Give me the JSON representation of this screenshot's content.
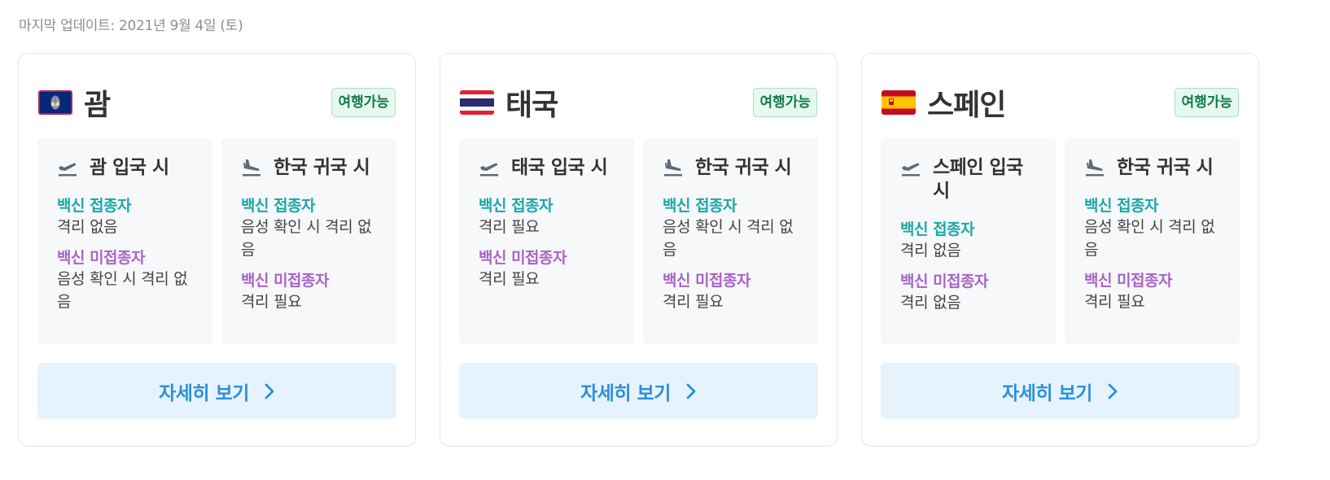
{
  "last_updated": "마지막 업데이트: 2021년 9월 4일 (토)",
  "colors": {
    "vaccinated": "#1aa8a8",
    "unvaccinated": "#a864c8",
    "badge": "#0f7b4b",
    "button": "#2b8fdc"
  },
  "cards": [
    {
      "country": "괌",
      "flag_icon": "guam-flag-icon",
      "badge": "여행가능",
      "entry": {
        "title": "괌 입국 시",
        "vaccinated_label": "백신 접종자",
        "vaccinated_value": "격리 없음",
        "unvaccinated_label": "백신 미접종자",
        "unvaccinated_value": "음성 확인 시 격리 없음"
      },
      "return": {
        "title": "한국 귀국 시",
        "vaccinated_label": "백신 접종자",
        "vaccinated_value": "음성 확인 시 격리 없음",
        "unvaccinated_label": "백신 미접종자",
        "unvaccinated_value": "격리 필요"
      },
      "button": "자세히 보기"
    },
    {
      "country": "태국",
      "flag_icon": "thailand-flag-icon",
      "badge": "여행가능",
      "entry": {
        "title": "태국 입국 시",
        "vaccinated_label": "백신 접종자",
        "vaccinated_value": "격리 필요",
        "unvaccinated_label": "백신 미접종자",
        "unvaccinated_value": "격리 필요"
      },
      "return": {
        "title": "한국 귀국 시",
        "vaccinated_label": "백신 접종자",
        "vaccinated_value": "음성 확인 시 격리 없음",
        "unvaccinated_label": "백신 미접종자",
        "unvaccinated_value": "격리 필요"
      },
      "button": "자세히 보기"
    },
    {
      "country": "스페인",
      "flag_icon": "spain-flag-icon",
      "badge": "여행가능",
      "entry": {
        "title": "스페인 입국 시",
        "vaccinated_label": "백신 접종자",
        "vaccinated_value": "격리 없음",
        "unvaccinated_label": "백신 미접종자",
        "unvaccinated_value": "격리 없음"
      },
      "return": {
        "title": "한국 귀국 시",
        "vaccinated_label": "백신 접종자",
        "vaccinated_value": "음성 확인 시 격리 없음",
        "unvaccinated_label": "백신 미접종자",
        "unvaccinated_value": "격리 필요"
      },
      "button": "자세히 보기"
    }
  ]
}
